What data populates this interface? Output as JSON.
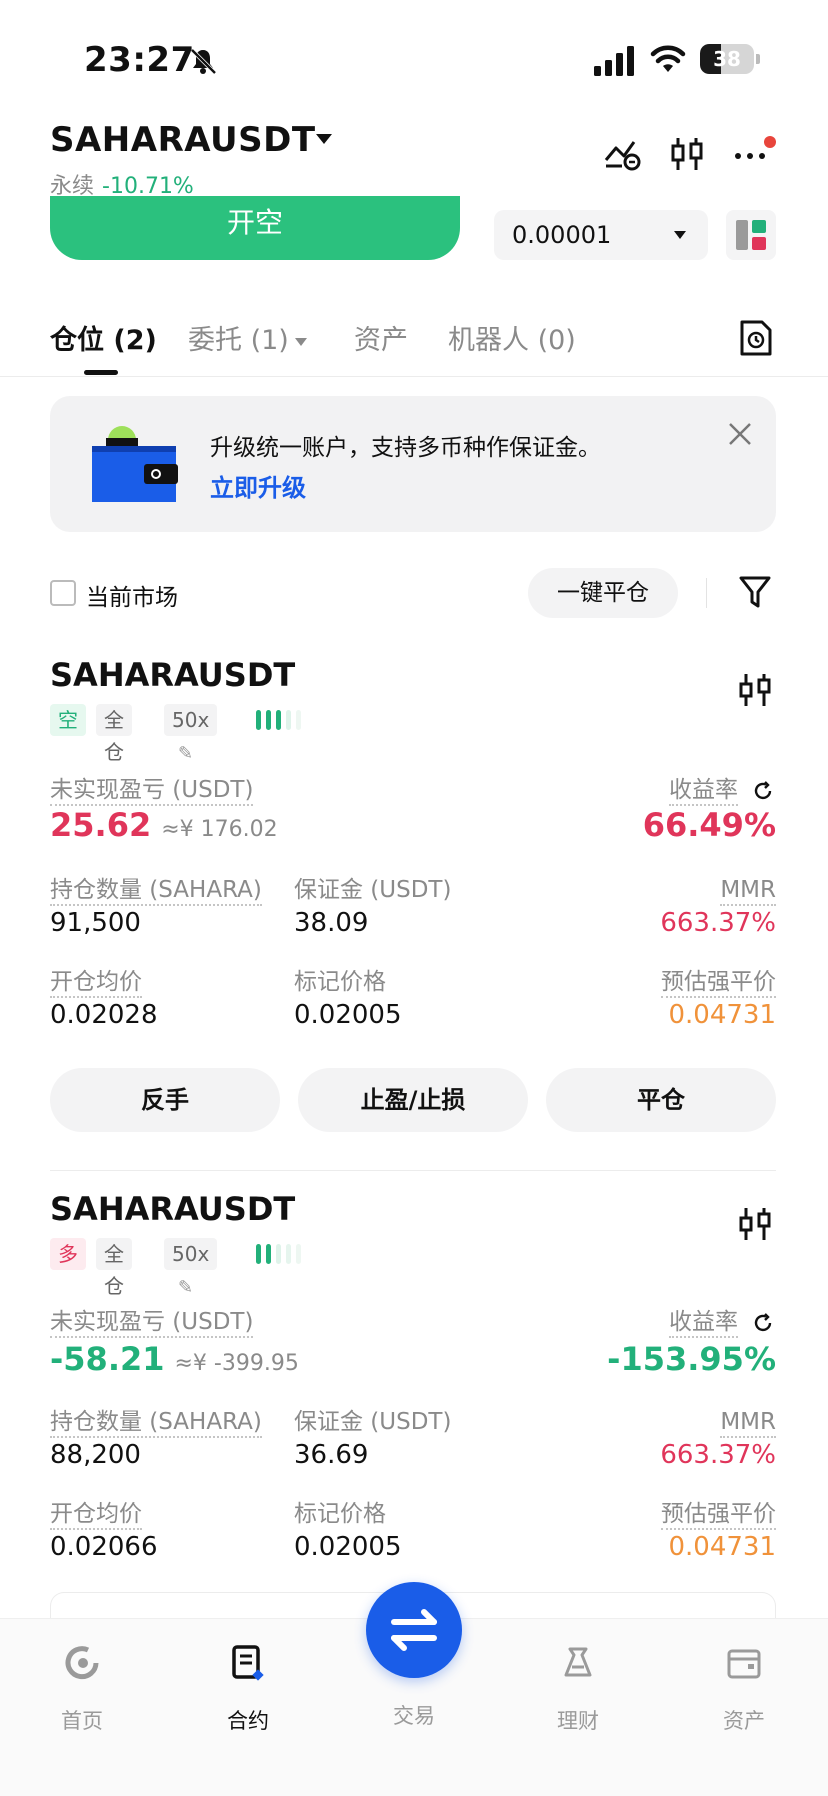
{
  "status_bar": {
    "time": "23:27",
    "battery": "38",
    "battery_level": 0.38
  },
  "header": {
    "pair": "SAHARAUSDT",
    "contract_type": "永续",
    "change": "-10.71%",
    "open_short_label": "开空",
    "price_precision": "0.00001"
  },
  "tabs": [
    {
      "label": "仓位 (2)"
    },
    {
      "label": "委托 (1)"
    },
    {
      "label": "资产"
    },
    {
      "label": "机器人 (0)"
    }
  ],
  "banner": {
    "text": "升级统一账户，支持多币种作保证金。",
    "link": "立即升级"
  },
  "filter": {
    "current_market": "当前市场",
    "close_all": "一键平仓"
  },
  "positions": [
    {
      "symbol": "SAHARAUSDT",
      "side": "空",
      "margin_mode": "全仓",
      "leverage": "50x",
      "pnl_label": "未实现盈亏 (USDT)",
      "pnl": "25.62",
      "pnl_cny": "≈¥ 176.02",
      "roe_label": "收益率",
      "roe": "66.49%",
      "qty_label": "持仓数量 (SAHARA)",
      "qty": "91,500",
      "margin_label": "保证金 (USDT)",
      "margin": "38.09",
      "mmr_label": "MMR",
      "mmr": "663.37%",
      "entry_label": "开仓均价",
      "entry": "0.02028",
      "mark_label": "标记价格",
      "mark": "0.02005",
      "liq_label": "预估强平价",
      "liq": "0.04731",
      "buttons": [
        "反手",
        "止盈/止损",
        "平仓"
      ]
    },
    {
      "symbol": "SAHARAUSDT",
      "side": "多",
      "margin_mode": "全仓",
      "leverage": "50x",
      "pnl_label": "未实现盈亏 (USDT)",
      "pnl": "-58.21",
      "pnl_cny": "≈¥ -399.95",
      "roe_label": "收益率",
      "roe": "-153.95%",
      "qty_label": "持仓数量 (SAHARA)",
      "qty": "88,200",
      "margin_label": "保证金 (USDT)",
      "margin": "36.69",
      "mmr_label": "MMR",
      "mmr": "663.37%",
      "entry_label": "开仓均价",
      "entry": "0.02066",
      "mark_label": "标记价格",
      "mark": "0.02005",
      "liq_label": "预估强平价",
      "liq": "0.04731"
    }
  ],
  "bottom_nav": [
    {
      "label": "首页",
      "icon": "home-icon"
    },
    {
      "label": "合约",
      "icon": "contract-icon"
    },
    {
      "label": "交易",
      "icon": "swap-icon"
    },
    {
      "label": "理财",
      "icon": "earn-icon"
    },
    {
      "label": "资产",
      "icon": "wallet-icon"
    }
  ],
  "colors": {
    "green": "#22b07a",
    "red": "#e0355a",
    "orange": "#f0923a",
    "blue": "#1a5de8",
    "open_short": "#2bc17e"
  }
}
